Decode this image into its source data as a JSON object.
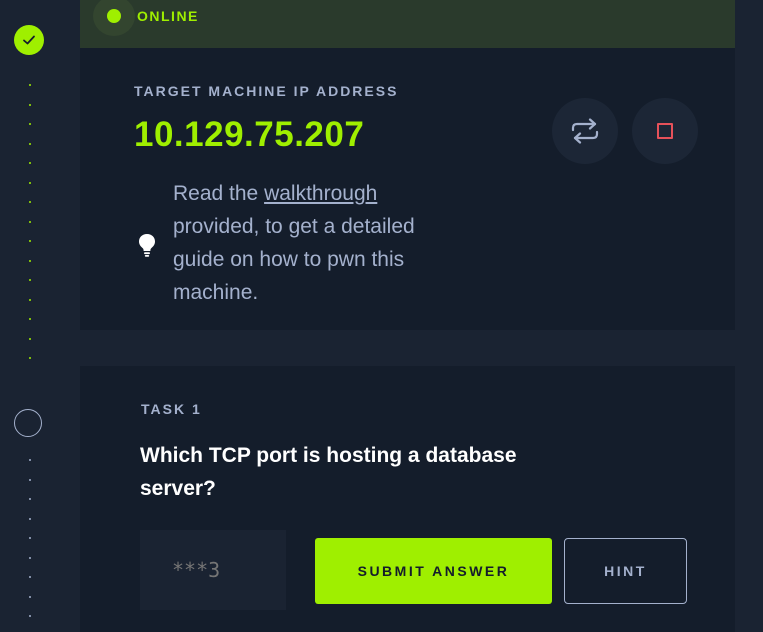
{
  "status": {
    "label": "ONLINE"
  },
  "target": {
    "label": "TARGET MACHINE IP ADDRESS",
    "ip": "10.129.75.207"
  },
  "controls": {
    "reset_icon": "reset-arrows-icon",
    "stop_icon": "stop-square-icon"
  },
  "walkthrough": {
    "prefix": "Read the ",
    "link": "walkthrough",
    "suffix": " provided, to get a detailed guide on how to pwn this machine.",
    "icon": "lightbulb-icon"
  },
  "task": {
    "label": "TASK 1",
    "question": "Which TCP port is hosting a database server?",
    "answer_placeholder": "***3",
    "submit_label": "SUBMIT ANSWER",
    "hint_label": "HINT"
  },
  "progress": {
    "completed_icon": "check-icon",
    "pending_icon": "empty-circle-icon"
  },
  "colors": {
    "accent": "#9fef00",
    "background": "#1a2332",
    "card": "#141d2b",
    "muted_text": "#a4b1cd",
    "danger": "#e6515a"
  }
}
